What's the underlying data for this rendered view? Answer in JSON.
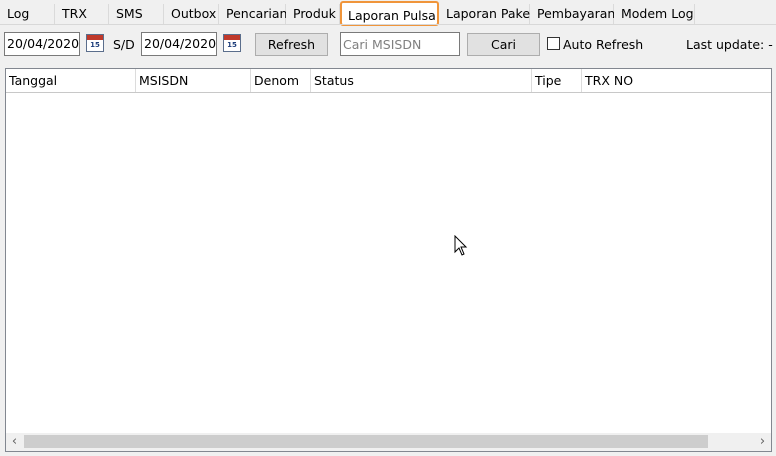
{
  "tabs": [
    {
      "label": "Log"
    },
    {
      "label": "TRX"
    },
    {
      "label": "SMS"
    },
    {
      "label": "Outbox"
    },
    {
      "label": "Pencarian"
    },
    {
      "label": "Produk"
    },
    {
      "label": "Laporan Pulsa",
      "active": true
    },
    {
      "label": "Laporan Paket"
    },
    {
      "label": "Pembayaran"
    },
    {
      "label": "Modem Log"
    }
  ],
  "toolbar": {
    "date_from": "20/04/2020",
    "date_to": "20/04/2020",
    "calendar_day": "15",
    "range_separator": "S/D",
    "refresh_label": "Refresh",
    "search_placeholder": "Cari MSISDN",
    "search_value": "",
    "search_button_label": "Cari",
    "auto_refresh_label": "Auto Refresh",
    "auto_refresh_checked": false,
    "last_update": "Last update: -"
  },
  "grid": {
    "columns": [
      "Tanggal",
      "MSISDN",
      "Denom",
      "Status",
      "Tipe",
      "TRX NO"
    ],
    "rows": []
  },
  "icons": {
    "calendar": "calendar-icon",
    "scroll_left": "‹",
    "scroll_right": "›"
  },
  "colors": {
    "active_tab_border": "#f0953b",
    "background": "#f0f0f0"
  }
}
